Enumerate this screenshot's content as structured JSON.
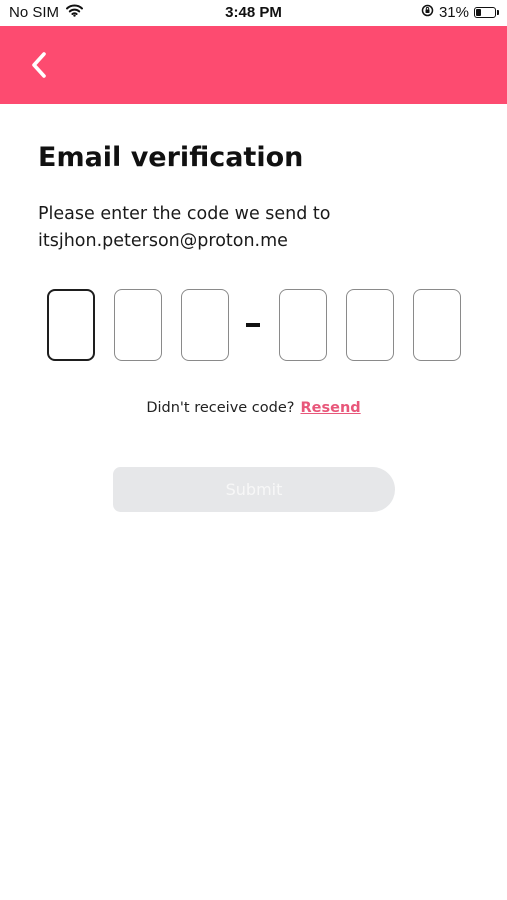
{
  "status_bar": {
    "carrier": "No SIM",
    "time": "3:48 PM",
    "battery_percent": "31%",
    "battery_level": 0.31,
    "icons": [
      "wifi-icon",
      "orientation-lock-icon",
      "battery-icon"
    ]
  },
  "header": {
    "background_color": "#fd4b70",
    "back_icon": "chevron-left-icon"
  },
  "main": {
    "title": "Email verification",
    "instruction_line1": "Please enter the code we send to",
    "email": "itsjhon.peterson@proton.me",
    "code_digits": [
      "",
      "",
      "",
      "",
      "",
      ""
    ],
    "separator": "-",
    "resend_prompt": "Didn't receive code?",
    "resend_label": "Resend",
    "resend_color": "#e8577a",
    "submit_label": "Submit"
  }
}
